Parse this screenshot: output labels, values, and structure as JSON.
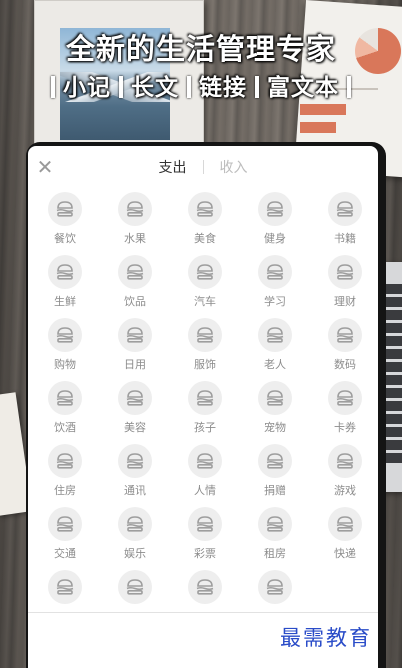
{
  "promo": {
    "headline": "全新的生活管理专家",
    "features": [
      "小记",
      "长文",
      "链接",
      "富文本"
    ]
  },
  "header": {
    "close_icon": "close-icon",
    "tabs": [
      {
        "label": "支出",
        "active": true
      },
      {
        "label": "收入",
        "active": false
      }
    ]
  },
  "categories": [
    {
      "label": "餐饮",
      "icon": "burger-icon"
    },
    {
      "label": "水果",
      "icon": "burger-icon"
    },
    {
      "label": "美食",
      "icon": "burger-icon"
    },
    {
      "label": "健身",
      "icon": "burger-icon"
    },
    {
      "label": "书籍",
      "icon": "burger-icon"
    },
    {
      "label": "生鲜",
      "icon": "burger-icon"
    },
    {
      "label": "饮品",
      "icon": "burger-icon"
    },
    {
      "label": "汽车",
      "icon": "burger-icon"
    },
    {
      "label": "学习",
      "icon": "burger-icon"
    },
    {
      "label": "理财",
      "icon": "burger-icon"
    },
    {
      "label": "购物",
      "icon": "burger-icon"
    },
    {
      "label": "日用",
      "icon": "burger-icon"
    },
    {
      "label": "服饰",
      "icon": "burger-icon"
    },
    {
      "label": "老人",
      "icon": "burger-icon"
    },
    {
      "label": "数码",
      "icon": "burger-icon"
    },
    {
      "label": "饮酒",
      "icon": "burger-icon"
    },
    {
      "label": "美容",
      "icon": "burger-icon"
    },
    {
      "label": "孩子",
      "icon": "burger-icon"
    },
    {
      "label": "宠物",
      "icon": "burger-icon"
    },
    {
      "label": "卡券",
      "icon": "burger-icon"
    },
    {
      "label": "住房",
      "icon": "burger-icon"
    },
    {
      "label": "通讯",
      "icon": "burger-icon"
    },
    {
      "label": "人情",
      "icon": "burger-icon"
    },
    {
      "label": "捐赠",
      "icon": "burger-icon"
    },
    {
      "label": "游戏",
      "icon": "burger-icon"
    },
    {
      "label": "交通",
      "icon": "burger-icon"
    },
    {
      "label": "娱乐",
      "icon": "burger-icon"
    },
    {
      "label": "彩票",
      "icon": "burger-icon"
    },
    {
      "label": "租房",
      "icon": "burger-icon"
    },
    {
      "label": "快递",
      "icon": "burger-icon"
    },
    {
      "label": "",
      "icon": "burger-icon"
    },
    {
      "label": "",
      "icon": "burger-icon"
    },
    {
      "label": "",
      "icon": "burger-icon"
    },
    {
      "label": "",
      "icon": "burger-icon"
    }
  ],
  "watermark": "最需教育",
  "colors": {
    "active_tab": "#333333",
    "inactive_tab": "#bdbdbd",
    "icon_bg": "#eeeeee",
    "icon_fg": "#9e9e9e",
    "label": "#8c8c8c",
    "watermark": "#2a4cc8"
  }
}
